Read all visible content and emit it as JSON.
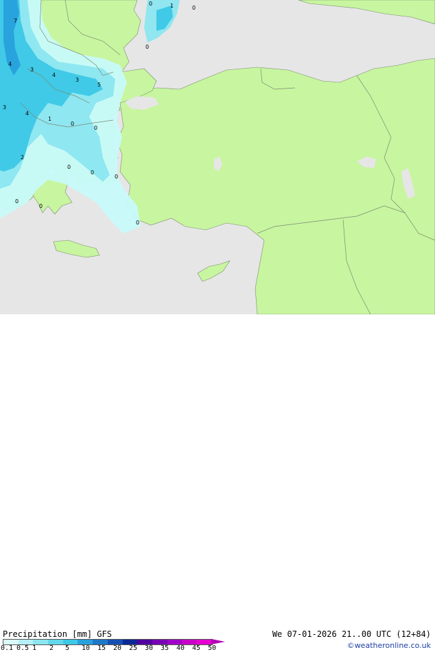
{
  "map": {
    "colors": {
      "sea": "#e6e6e6",
      "land": "#c8f5a0",
      "border": "#7a8a70",
      "precip_light": "#c8fafa",
      "precip_med": "#8ce6f0",
      "precip_heavy": "#3cc8e6",
      "precip_strong": "#28a0dc"
    },
    "labels": [
      {
        "text": "0"
      },
      {
        "text": "1"
      },
      {
        "text": "0"
      },
      {
        "text": "7"
      },
      {
        "text": "0"
      },
      {
        "text": "4"
      },
      {
        "text": "3"
      },
      {
        "text": "4"
      },
      {
        "text": "3"
      },
      {
        "text": "5"
      },
      {
        "text": "3"
      },
      {
        "text": "4"
      },
      {
        "text": "1"
      },
      {
        "text": "0"
      },
      {
        "text": "0"
      },
      {
        "text": "2"
      },
      {
        "text": "0"
      },
      {
        "text": "0"
      },
      {
        "text": "0"
      },
      {
        "text": "0"
      },
      {
        "text": "0"
      },
      {
        "text": "0"
      }
    ]
  },
  "footer": {
    "title": "Precipitation [mm] GFS",
    "datetime": "We 07-01-2026 21..00 UTC (12+84)",
    "credit": "©weatheronline.co.uk",
    "legend": {
      "ticks": [
        "0.1",
        "0.5",
        "1",
        "2",
        "5",
        "10",
        "15",
        "20",
        "25",
        "30",
        "35",
        "40",
        "45",
        "50"
      ],
      "colors": [
        "#dcfafa",
        "#b4f0f5",
        "#8ce6f0",
        "#64d7eb",
        "#3cc8e6",
        "#28a0dc",
        "#1e78c8",
        "#1450b4",
        "#0a2896",
        "#5000a0",
        "#7800b4",
        "#a000c8",
        "#c800c8",
        "#e600d2"
      ]
    }
  }
}
